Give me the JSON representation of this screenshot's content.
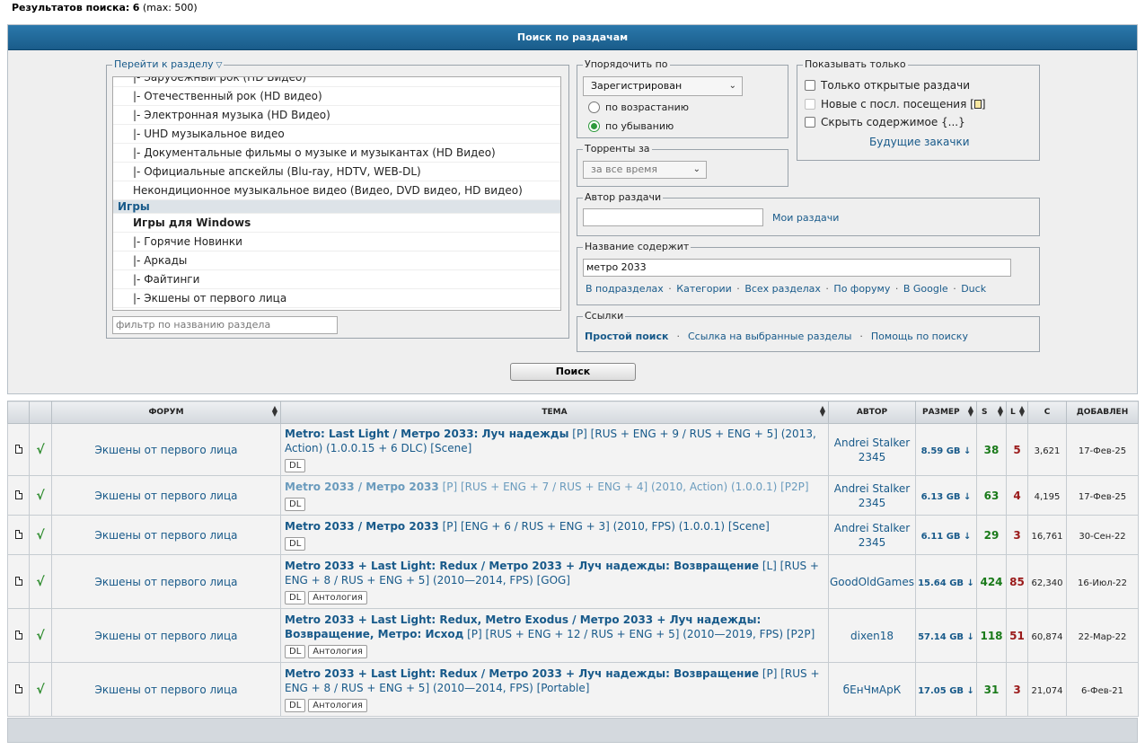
{
  "results": {
    "label": "Результатов поиска:",
    "count": "6",
    "max": "(max: 500)"
  },
  "panel": {
    "title": "Поиск по раздачам"
  },
  "section": {
    "legend": "Перейти к разделу",
    "items": [
      {
        "label": "|- Зарубежный рок (HD Видео)",
        "kind": "child"
      },
      {
        "label": "|- Отечественный рок (HD видео)",
        "kind": "child"
      },
      {
        "label": "|- Электронная музыка (HD Видео)",
        "kind": "child"
      },
      {
        "label": "|- UHD музыкальное видео",
        "kind": "child"
      },
      {
        "label": "|- Документальные фильмы о музыке и музыкантах (HD Видео)",
        "kind": "child"
      },
      {
        "label": "|- Официальные апскейлы (Blu-ray, HDTV, WEB-DL)",
        "kind": "child"
      },
      {
        "label": "Некондиционное музыкальное видео (Видео, DVD видео, HD видео)",
        "kind": "top"
      },
      {
        "label": "Игры",
        "kind": "grp"
      },
      {
        "label": "Игры для Windows",
        "kind": "sub"
      },
      {
        "label": "|- Горячие Новинки",
        "kind": "child"
      },
      {
        "label": "|- Аркады",
        "kind": "child"
      },
      {
        "label": "|- Файтинги",
        "kind": "child"
      },
      {
        "label": "|- Экшены от первого лица",
        "kind": "child"
      }
    ],
    "filter_placeholder": "фильтр по названию раздела"
  },
  "order": {
    "legend": "Упорядочить по",
    "selected": "Зарегистрирован",
    "asc": "по возрастанию",
    "desc": "по убыванию"
  },
  "torrents_for": {
    "legend": "Торренты за",
    "selected": "за все время"
  },
  "show_only": {
    "legend": "Показывать только",
    "open": "Только открытые раздачи",
    "new": "Новые с посл. посещения [",
    "new_end": "]",
    "hide": "Скрыть содержимое {...}",
    "future": "Будущие закачки"
  },
  "author": {
    "legend": "Автор раздачи",
    "value": "",
    "my": "Мои раздачи"
  },
  "title_contains": {
    "legend": "Название содержит",
    "value": "метро 2033",
    "links": [
      "В подразделах",
      "Категории",
      "Всех разделах",
      "По форуму",
      "В Google",
      "Duck"
    ]
  },
  "refs": {
    "legend": "Ссылки",
    "simple": "Простой поиск",
    "selected": "Ссылка на выбранные разделы",
    "help": "Помощь по поиску"
  },
  "search_button": "Поиск",
  "columns": {
    "forum": "ФОРУМ",
    "topic": "ТЕМА",
    "author": "АВТОР",
    "size": "РАЗМЕР",
    "s": "S",
    "l": "L",
    "c": "C",
    "added": "ДОБАВЛЕН"
  },
  "rows": [
    {
      "check": "√",
      "forum": "Экшены от первого лица",
      "title": "Metro: Last Light / Метро 2033: Луч надежды",
      "rest": " [P] [RUS + ENG + 9 / RUS + ENG + 5] (2013, Action) (1.0.0.15 + 6 DLC) [Scene]",
      "tag1": "DL",
      "tag2": "",
      "author": "Andrei Stalker 2345",
      "size": "8.59 GB ↓",
      "s": "38",
      "l": "5",
      "c": "3,621",
      "added": "17-Фев-25",
      "visited": false
    },
    {
      "check": "√",
      "forum": "Экшены от первого лица",
      "title": "Metro 2033 / Метро 2033",
      "rest": " [P] [RUS + ENG + 7 / RUS + ENG + 4] (2010, Action) (1.0.0.1) [P2P]",
      "tag1": "DL",
      "tag2": "",
      "author": "Andrei Stalker 2345",
      "size": "6.13 GB ↓",
      "s": "63",
      "l": "4",
      "c": "4,195",
      "added": "17-Фев-25",
      "visited": true
    },
    {
      "check": "√",
      "forum": "Экшены от первого лица",
      "title": "Metro 2033 / Метро 2033",
      "rest": " [P] [ENG + 6 / RUS + ENG + 3] (2010, FPS) (1.0.0.1) [Scene]",
      "tag1": "DL",
      "tag2": "",
      "author": "Andrei Stalker 2345",
      "size": "6.11 GB ↓",
      "s": "29",
      "l": "3",
      "c": "16,761",
      "added": "30-Сен-22",
      "visited": false
    },
    {
      "check": "√",
      "forum": "Экшены от первого лица",
      "title": "Metro 2033 + Last Light: Redux / Метро 2033 + Луч надежды: Возвращение",
      "rest": " [L] [RUS + ENG + 8 / RUS + ENG + 5] (2010—2014, FPS) [GOG]",
      "tag1": "DL",
      "tag2": "Антология",
      "author": "GoodOldGames",
      "size": "15.64 GB ↓",
      "s": "424",
      "l": "85",
      "c": "62,340",
      "added": "16-Июл-22",
      "visited": false
    },
    {
      "check": "√",
      "forum": "Экшены от первого лица",
      "title": "Metro 2033 + Last Light: Redux, Metro Exodus / Метро 2033 + Луч надежды: Возвращение, Метро: Исход",
      "rest": " [P] [RUS + ENG + 12 / RUS + ENG + 5] (2010—2019, FPS) [P2P]",
      "tag1": "DL",
      "tag2": "Антология",
      "author": "dixen18",
      "size": "57.14 GB ↓",
      "s": "118",
      "l": "51",
      "c": "60,874",
      "added": "22-Мар-22",
      "visited": false
    },
    {
      "check": "√",
      "forum": "Экшены от первого лица",
      "title": "Metro 2033 + Last Light: Redux / Метро 2033 + Луч надежды: Возвращение",
      "rest": " [P] [RUS + ENG + 8 / RUS + ENG + 5] (2010—2014, FPS) [Portable]",
      "tag1": "DL",
      "tag2": "Антология",
      "author": "бЕнЧмАрК",
      "size": "17.05 GB ↓",
      "s": "31",
      "l": "3",
      "c": "21,074",
      "added": "6-Фев-21",
      "visited": false
    }
  ]
}
